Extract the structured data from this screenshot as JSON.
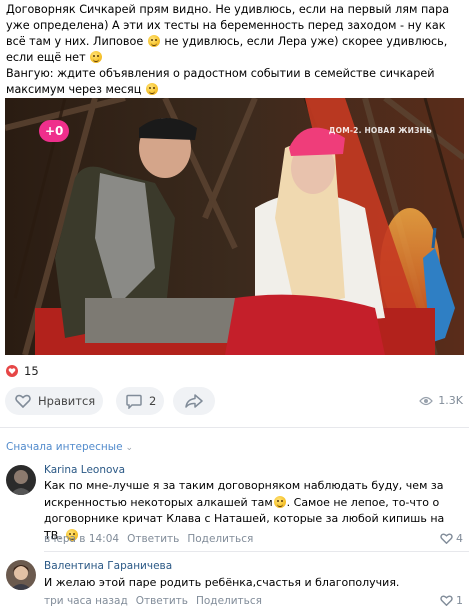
{
  "post": {
    "text_1": "Договорняк Сичкарей прям видно. Не удивлюсь, если на первый лям пара уже определена) А эти их тесты на беременность перед заходом - ну как всё там у них. Липовое ",
    "text_2": " не удивлюсь, если Лера уже) скорее удивлюсь, если ещё нет ",
    "text_3": "Вангую: ждите объявления о радостном событии в семействе сичкарей максимум через месяц "
  },
  "video": {
    "channel_logo": "+0",
    "show_name": "ДОМ-2. НОВАЯ ЖИЗНЬ"
  },
  "reactions": {
    "likes_count": "15",
    "like_label": "Нравится",
    "comments_count": "2",
    "views": "1.3K",
    "icons": {
      "heart": "heart-icon",
      "comment": "comment-icon",
      "share": "share-icon",
      "views": "eye-icon"
    }
  },
  "comments_section": {
    "sort_label": "Сначала интересные"
  },
  "comments": [
    {
      "author": "Karina Leonova",
      "text_1": "Как по мне-лучше я за таким договорняком наблюдать буду, чем за искренностью некоторых алкашей там",
      "text_2": ". Самое не лепое, то-что о договорнике кричат Клава с Наташей, которые за любой кипишь на ТВ. ",
      "time": "вчера в 14:04",
      "reply_label": "Ответить",
      "share_label": "Поделиться",
      "likes": "4"
    },
    {
      "author": "Валентина Гараничева",
      "text_1": "И желаю этой паре родить ребёнка,счастья и благополучия.",
      "time": "три часа назад",
      "reply_label": "Ответить",
      "share_label": "Поделиться",
      "likes": "1"
    }
  ],
  "colors": {
    "link": "#2a5885",
    "accent": "#528bcc",
    "muted": "#818c99",
    "pill_bg": "#f0f2f5",
    "heart": "#e64646"
  }
}
